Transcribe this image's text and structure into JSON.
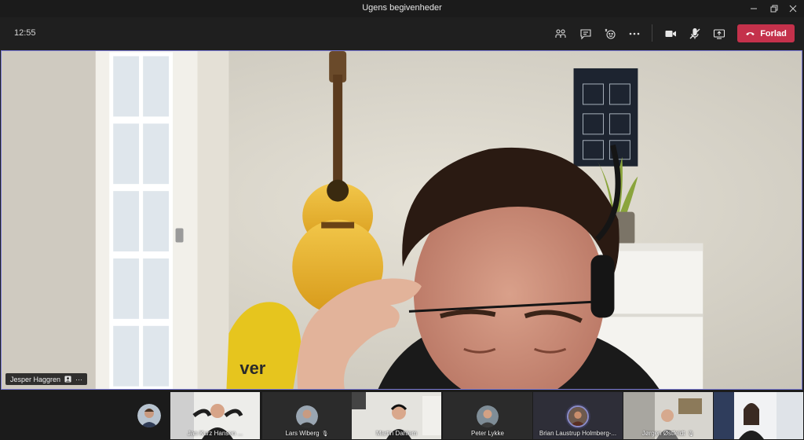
{
  "window": {
    "title": "Ugens begivenheder",
    "controls": [
      "minimize-icon",
      "restore-icon",
      "close-icon"
    ]
  },
  "toolbar": {
    "time": "12:55",
    "icons": [
      "participants-icon",
      "chat-icon",
      "reactions-icon",
      "more-options-icon",
      "camera-icon",
      "mic-muted-icon",
      "share-screen-icon"
    ],
    "leave_label": "Forlad",
    "leave_color": "#c4314b"
  },
  "main_video": {
    "presenter_name": "Jesper Haggren",
    "more_label": "···",
    "border_color": "#7b7bd6"
  },
  "participants": [
    {
      "name": "Jan Kurz Hansen ...",
      "muted": false
    },
    {
      "name": "Lars Wiberg",
      "muted": true
    },
    {
      "name": "Martin Dahlem",
      "muted": false
    },
    {
      "name": "Peter Lykke",
      "muted": false
    },
    {
      "name": "Brian Laustrup Holmberg-...",
      "muted": false
    },
    {
      "name": "Jørgen Østfeldt",
      "muted": true
    },
    {
      "name": "",
      "muted": false
    }
  ]
}
